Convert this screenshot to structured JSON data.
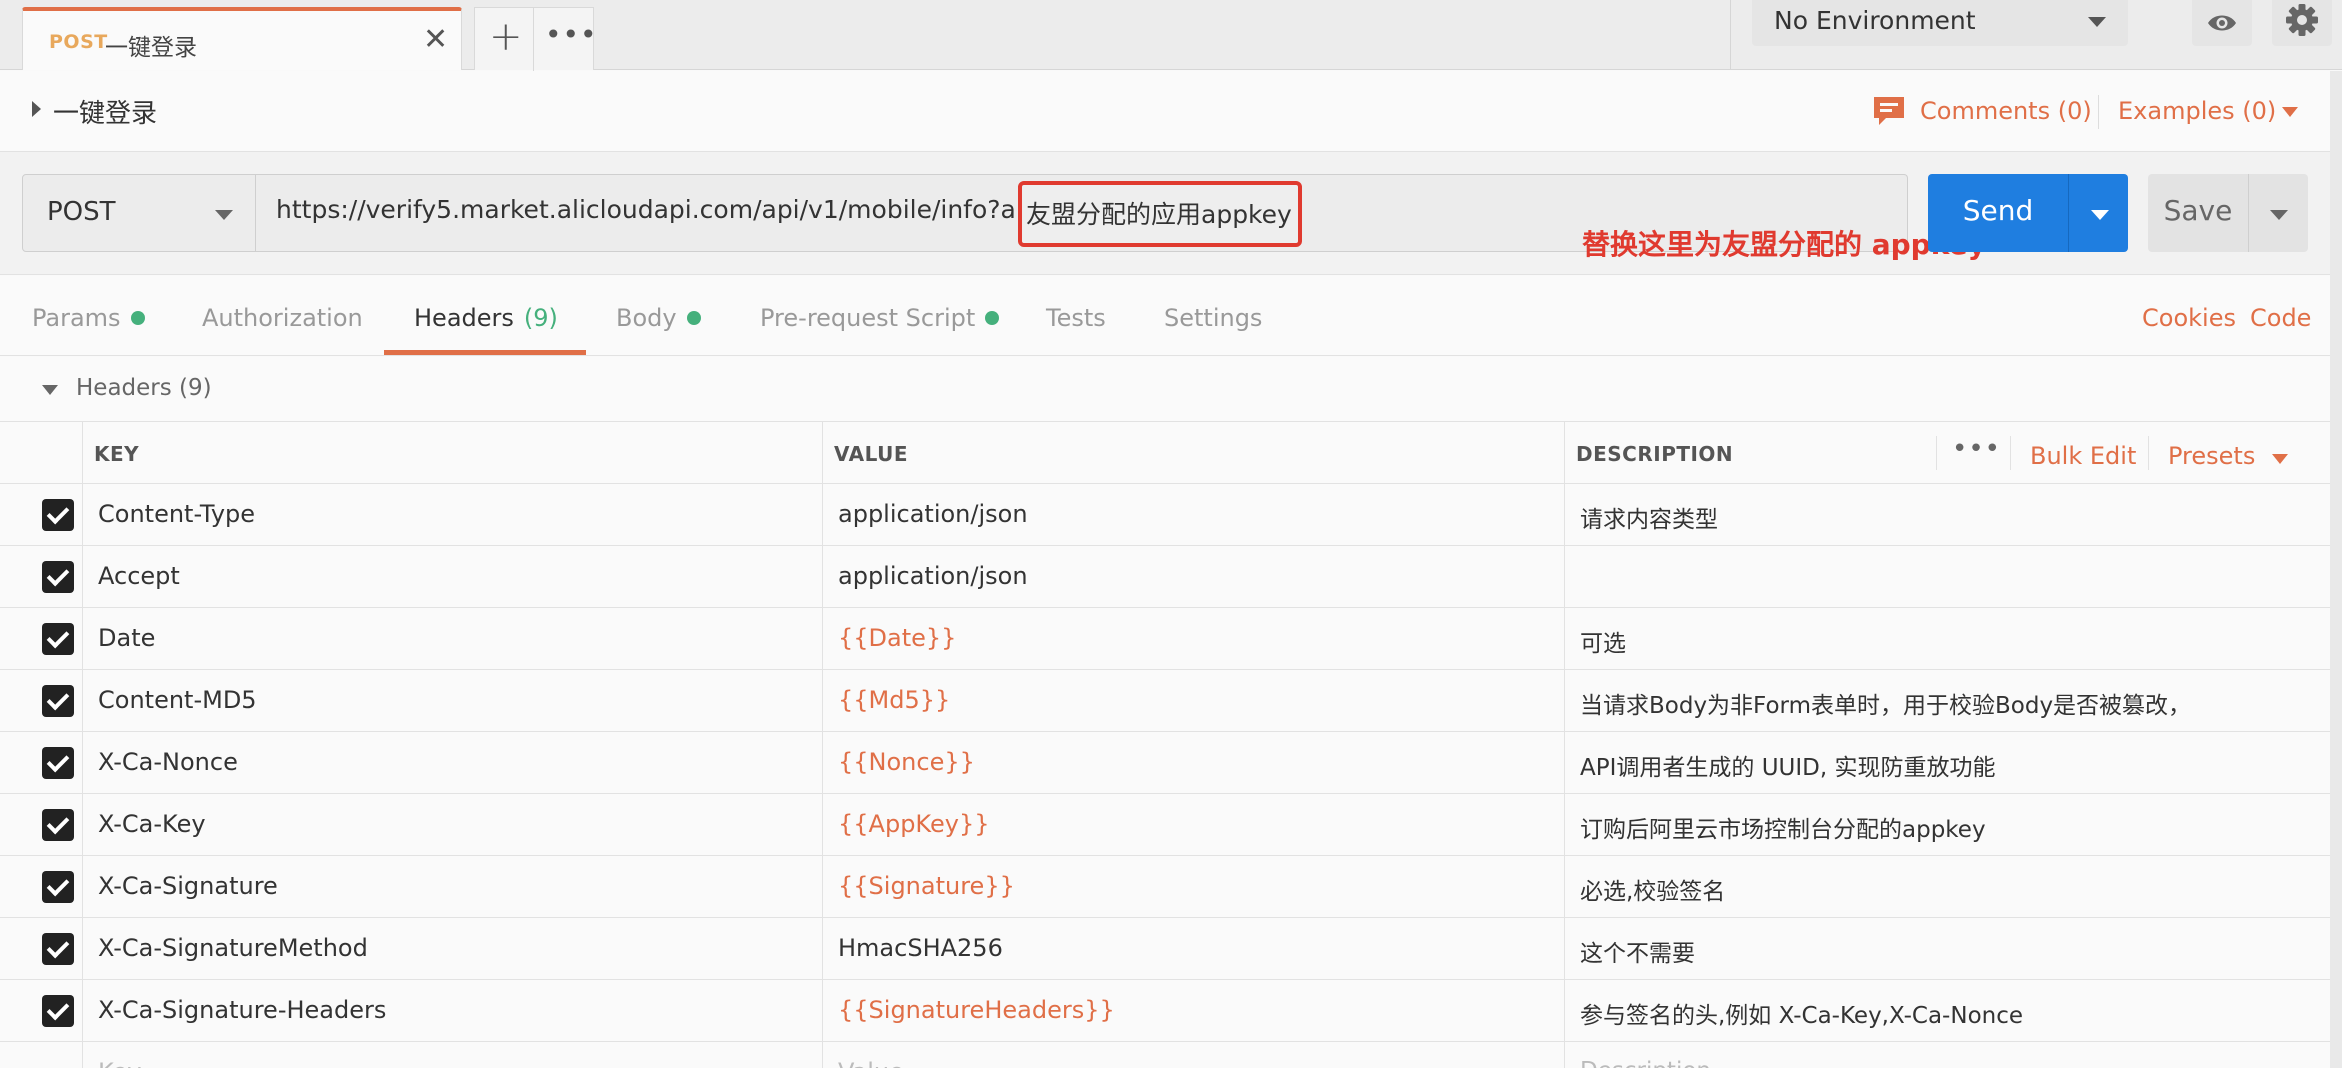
{
  "tab": {
    "method": "POST",
    "name": "一键登录"
  },
  "environment": {
    "selected": "No Environment"
  },
  "request": {
    "title": "一键登录",
    "comments": "Comments (0)",
    "examples": "Examples (0)",
    "method": "POST",
    "url_prefix": "https://verify5.market.alicloudapi.com/api/v1/mobile/info?appkey=",
    "url_highlight": "友盟分配的应用appkey",
    "annotation": "替换这里为友盟分配的 appkey",
    "send_label": "Send",
    "save_label": "Save"
  },
  "subtabs": {
    "params": "Params",
    "authorization": "Authorization",
    "headers": "Headers",
    "headers_count": "(9)",
    "body": "Body",
    "prerequest": "Pre-request Script",
    "tests": "Tests",
    "settings": "Settings",
    "cookies": "Cookies",
    "code": "Code"
  },
  "headers_section": {
    "title": "Headers",
    "count": "(9)",
    "columns": {
      "key": "KEY",
      "value": "VALUE",
      "description": "DESCRIPTION"
    },
    "bulk_edit": "Bulk Edit",
    "presets": "Presets",
    "rows": [
      {
        "key": "Content-Type",
        "value": "application/json",
        "description": "请求内容类型"
      },
      {
        "key": "Accept",
        "value": "application/json",
        "description": ""
      },
      {
        "key": "Date",
        "value": "{{Date}}",
        "description": "可选"
      },
      {
        "key": "Content-MD5",
        "value": "{{Md5}}",
        "description": "当请求Body为非Form表单时，用于校验Body是否被篡改，"
      },
      {
        "key": "X-Ca-Nonce",
        "value": "{{Nonce}}",
        "description": "API调用者生成的 UUID, 实现防重放功能"
      },
      {
        "key": "X-Ca-Key",
        "value": "{{AppKey}}",
        "description": "订购后阿里云市场控制台分配的appkey"
      },
      {
        "key": "X-Ca-Signature",
        "value": "{{Signature}}",
        "description": "必选,校验签名"
      },
      {
        "key": "X-Ca-SignatureMethod",
        "value": "HmacSHA256",
        "description": "这个不需要"
      },
      {
        "key": "X-Ca-Signature-Headers",
        "value": "{{SignatureHeaders}}",
        "description": "参与签名的头,例如 X-Ca-Key,X-Ca-Nonce"
      }
    ],
    "placeholder": {
      "key": "Key",
      "value": "Value",
      "description": "Description"
    }
  },
  "colors": {
    "accent": "#e06f47",
    "send": "#1f7ee0",
    "annotation": "#e03a2f",
    "dot": "#45b07c"
  }
}
